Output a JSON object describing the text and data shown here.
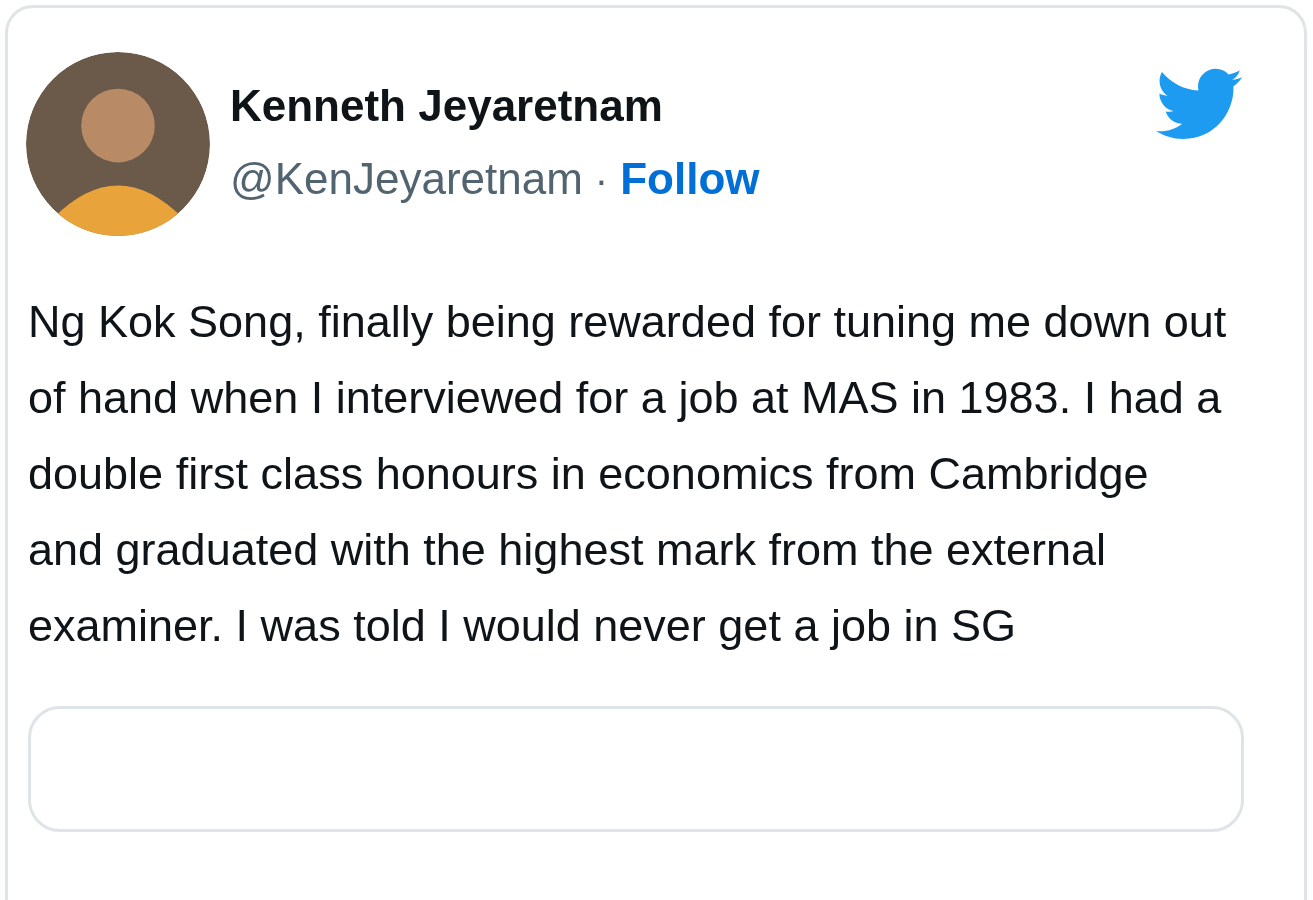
{
  "tweet": {
    "author": {
      "name": "Kenneth Jeyaretnam",
      "handle": "@KenJeyaretnam",
      "separator": "·",
      "follow": "Follow"
    },
    "text": "Ng Kok Song, finally being rewarded for tuning me down out of hand when I interviewed for a job at MAS in 1983. I had a double first class honours in economics from Cambridge and graduated with the highest mark from the external examiner. I was told I would never get a job in SG",
    "quoted_card": {
      "kind": "card"
    }
  }
}
